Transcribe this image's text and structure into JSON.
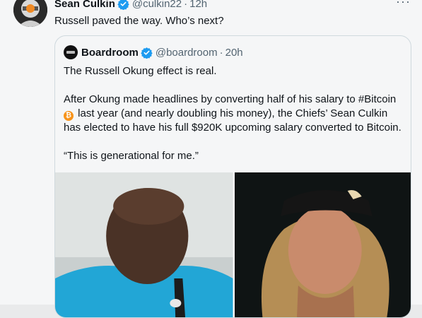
{
  "tweet": {
    "author_name": "Sean Culkin",
    "handle": "@culkin22",
    "time": "12h",
    "separator": "·",
    "more": "···",
    "text": "Russell paved the way. Who’s next?"
  },
  "quote": {
    "author_name": "Boardroom",
    "handle": "@boardroom",
    "time": "20h",
    "separator": "·",
    "line1": "The Russell Okung effect is real.",
    "para2_before_icon": "After Okung made headlines by converting half of his salary to #Bitcoin",
    "btc_symbol": "₿",
    "para2_after_icon": "last year (and nearly doubling his money), the Chiefs’ Sean Culkin has elected to have his full $920K  upcoming salary converted to Bitcoin.",
    "line3": "“This is generational for me.”"
  },
  "colors": {
    "verified": "#1d9bf0",
    "secondary_text": "#536471",
    "bitcoin": "#f7931a",
    "border": "#cfd9de"
  },
  "icons": {
    "verified": "verified-badge-icon",
    "bitcoin": "bitcoin-icon",
    "more": "more-icon"
  }
}
